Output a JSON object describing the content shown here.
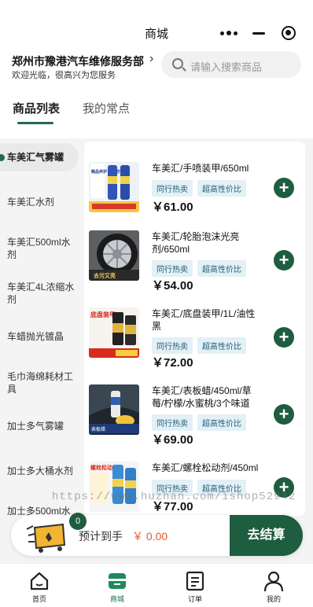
{
  "window": {
    "title": "商城"
  },
  "store": {
    "name": "郑州市豫港汽车维修服务部",
    "welcome": "欢迎光临，很高兴为您服务"
  },
  "search": {
    "placeholder": "请输入搜索商品"
  },
  "tabs": [
    {
      "label": "商品列表",
      "active": true
    },
    {
      "label": "我的常点",
      "active": false
    }
  ],
  "categories": [
    {
      "label": "车美汇气雾罐",
      "active": true
    },
    {
      "label": "车美汇水剂"
    },
    {
      "label": "车美汇500ml水剂"
    },
    {
      "label": "车美汇4L浓缩水剂"
    },
    {
      "label": "车蜡抛光镀晶"
    },
    {
      "label": "毛巾海绵耗材工具"
    },
    {
      "label": "加士多气雾罐"
    },
    {
      "label": "加士多大桶水剂"
    },
    {
      "label": "加士多500ml水"
    }
  ],
  "products": [
    {
      "name": "车美汇/手喷装甲/650ml",
      "tags": [
        "同行热卖",
        "超高性价比"
      ],
      "price": "￥61.00",
      "thumb_label": "精品养护 深度防锈"
    },
    {
      "name": "车美汇/轮胎泡沫光亮剂/650ml",
      "tags": [
        "同行热卖",
        "超高性价比"
      ],
      "price": "￥54.00",
      "thumb_label": "去污又亮"
    },
    {
      "name": "车美汇/底盘装甲/1L/油性黑",
      "tags": [
        "同行热卖",
        "超高性价比"
      ],
      "price": "￥72.00",
      "thumb_label": "底盘装甲"
    },
    {
      "name": "车美汇/表板蜡/450ml/草莓/柠檬/水蜜桃/3个味道",
      "tags": [
        "同行热卖",
        "超高性价比"
      ],
      "price": "￥69.00",
      "thumb_label": "表板蜡"
    },
    {
      "name": "车美汇/螺栓松动剂/450ml",
      "tags": [
        "同行热卖",
        "超高性价比"
      ],
      "price": "￥77.00",
      "thumb_label": "螺栓松动剂"
    }
  ],
  "watermark": "https://www.huzhan.com/ishop52942",
  "cart": {
    "count": "0",
    "label": "预计到手",
    "total": "￥ 0.00",
    "checkout_label": "去结算"
  },
  "bottom_nav": [
    {
      "label": "首页",
      "icon": "home-icon"
    },
    {
      "label": "商城",
      "icon": "store-icon",
      "active": true
    },
    {
      "label": "订单",
      "icon": "order-icon"
    },
    {
      "label": "我的",
      "icon": "user-icon"
    }
  ],
  "colors": {
    "accent": "#1e6b48",
    "button": "#1e5d3f",
    "price_orange": "#e05c2a",
    "tag_bg": "#e3f0f6",
    "tag_text": "#1f5d77"
  }
}
